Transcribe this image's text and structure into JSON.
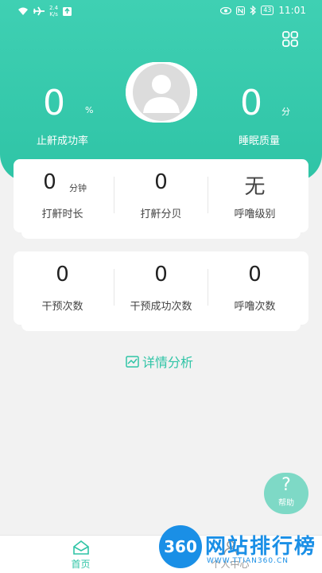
{
  "status_bar": {
    "speed_top": "2.4",
    "speed_bottom": "K/s",
    "battery": "43",
    "time": "11:01"
  },
  "hero": {
    "left_stat": {
      "value": "0",
      "unit": "%",
      "label": "止鼾成功率"
    },
    "right_stat": {
      "value": "0",
      "unit": "分",
      "label": "睡眠质量"
    }
  },
  "card1": {
    "items": [
      {
        "value": "0",
        "unit": "分钟",
        "label": "打鼾时长"
      },
      {
        "value": "0",
        "unit": "",
        "label": "打鼾分贝"
      },
      {
        "value": "无",
        "unit": "",
        "label": "呼噜级别"
      }
    ]
  },
  "card2": {
    "items": [
      {
        "value": "0",
        "label": "干预次数"
      },
      {
        "value": "0",
        "label": "干预成功次数"
      },
      {
        "value": "0",
        "label": "呼噜次数"
      }
    ]
  },
  "detail_link": "详情分析",
  "help_button": {
    "symbol": "?",
    "label": "帮助"
  },
  "tabbar": {
    "tabs": [
      {
        "label": "首页"
      },
      {
        "label": "个人中心"
      }
    ]
  },
  "watermark": {
    "logo": "360",
    "title": "网站排行榜",
    "url": "WWW.TTIAN360.CN"
  },
  "colors": {
    "primary": "#2fc4a6",
    "hero_top": "#3fd0b3",
    "help_fab": "#7ed9c6",
    "watermark_blue": "#1a8fe6"
  },
  "icons": [
    "grid-menu-icon",
    "wifi-icon",
    "airplane-icon",
    "eye-icon",
    "nfc-icon",
    "bluetooth-icon",
    "battery-icon",
    "chart-icon",
    "home-icon",
    "person-icon"
  ]
}
